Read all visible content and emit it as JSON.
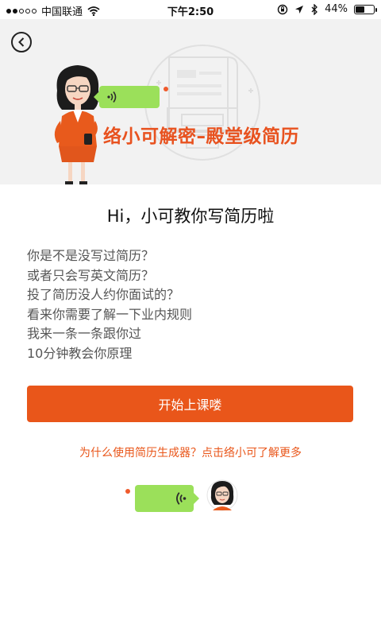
{
  "status_bar": {
    "carrier": "中国联通",
    "time": "下午2:50",
    "battery_percent": "44%",
    "battery_level": 0.44
  },
  "header": {
    "back_icon": "chevron-left-icon",
    "title": "络小可解密–殿堂级简历"
  },
  "content": {
    "greeting": "Hi，小可教你写简历啦",
    "lines": [
      "你是不是没写过简历？",
      "或者只会写英文简历？",
      "投了简历没人约你面试的？",
      "看来你需要了解一下业内规则",
      "我来一条一条跟你过",
      "10分钟教会你原理"
    ],
    "start_button": "开始上课喽",
    "more_link": "为什么使用简历生成器？点击络小可了解更多"
  },
  "colors": {
    "accent": "#e9561a",
    "bubble": "#9be05a",
    "header_bg": "#f2f2f2"
  }
}
